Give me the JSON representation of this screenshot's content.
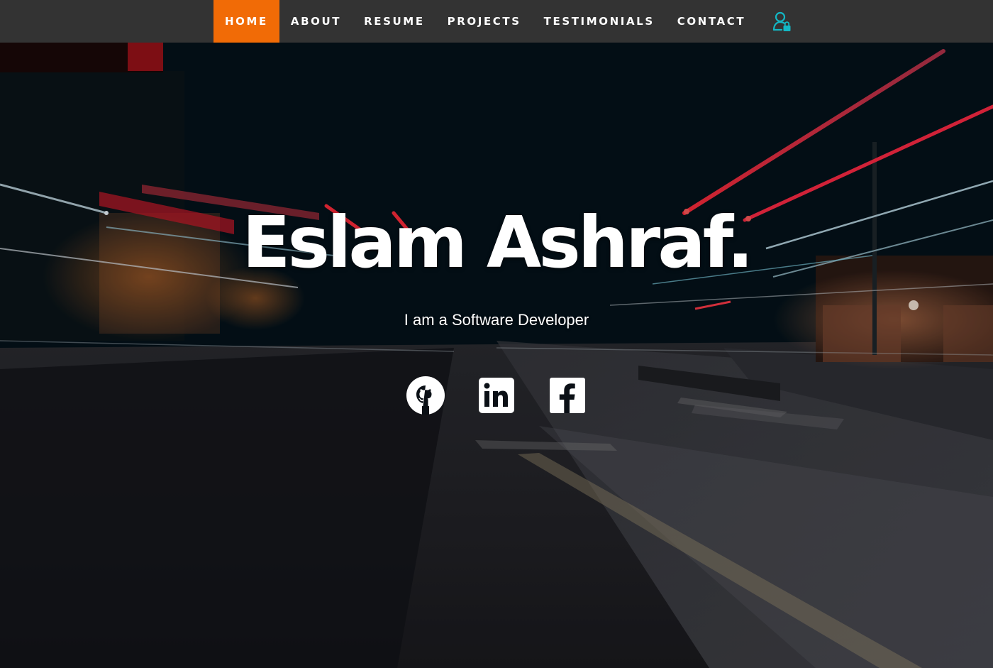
{
  "nav": {
    "items": [
      {
        "label": "HOME",
        "active": true
      },
      {
        "label": "ABOUT",
        "active": false
      },
      {
        "label": "RESUME",
        "active": false
      },
      {
        "label": "PROJECTS",
        "active": false
      },
      {
        "label": "TESTIMONIALS",
        "active": false
      },
      {
        "label": "CONTACT",
        "active": false
      }
    ],
    "user_icon": "user-lock-icon"
  },
  "hero": {
    "title": "Eslam Ashraf.",
    "subtitle": "I am a Software Developer"
  },
  "social": [
    {
      "icon": "github-icon"
    },
    {
      "icon": "linkedin-icon"
    },
    {
      "icon": "facebook-icon"
    }
  ],
  "colors": {
    "nav_background": "#333333",
    "active_accent": "#f16b06",
    "user_icon": "#13b7c4",
    "text": "#ffffff"
  }
}
